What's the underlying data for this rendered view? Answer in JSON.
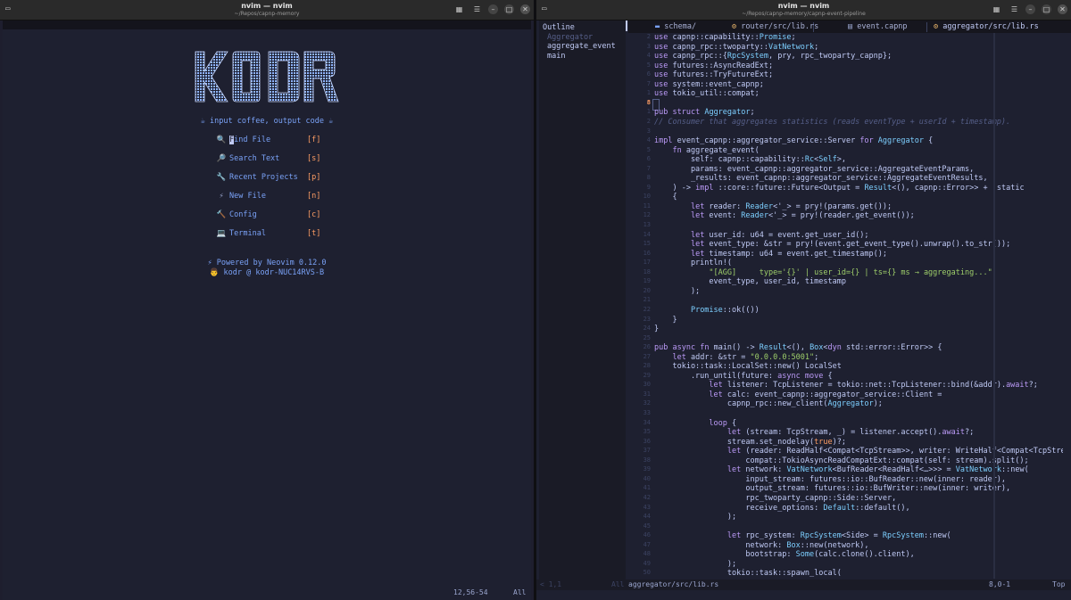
{
  "left_window": {
    "title": "nvim — nvim",
    "subtitle": "~/Repos/capnp-memory",
    "logo_text": "KODR",
    "tagline": "☕ input coffee, output code ☕",
    "menu": [
      {
        "icon": "🔍",
        "label": "Find File",
        "key": "[f]"
      },
      {
        "icon": "🔎",
        "label": "Search Text",
        "key": "[s]"
      },
      {
        "icon": "🔧",
        "label": "Recent Projects",
        "key": "[p]"
      },
      {
        "icon": "⚡",
        "label": "New File",
        "key": "[n]"
      },
      {
        "icon": "🔨",
        "label": "Config",
        "key": "[c]"
      },
      {
        "icon": "💻",
        "label": "Terminal",
        "key": "[t]"
      }
    ],
    "footer_powered": "⚡ Powered by Neovim 0.12.0",
    "footer_user": "👨 kodr @ kodr-NUC14RVS-B",
    "status_pos": "12,56-54",
    "status_all": "All"
  },
  "right_window": {
    "title": "nvim — nvim",
    "subtitle": "~/Repos/capnp-memory/capnp-event-pipeline",
    "outline": {
      "header": "Outline",
      "items": [
        "Aggregator",
        "aggregate_event",
        "main"
      ]
    },
    "tabs": [
      {
        "label": "schema/"
      },
      {
        "label": "router/src/lib.rs"
      },
      {
        "label": "event.capnp"
      },
      {
        "label": "aggregator/src/lib.rs"
      }
    ],
    "status": {
      "left": "< 1,1",
      "mid_all": "All",
      "file": "aggregator/src/lib.rs",
      "pos": "8,0-1",
      "top": "Top"
    }
  },
  "code_lines": [
    {
      "n": "2",
      "t": "use capnp::capability::Promise;"
    },
    {
      "n": "3",
      "t": "use capnp_rpc::twoparty::VatNetwork;"
    },
    {
      "n": "4",
      "t": "use capnp_rpc::{RpcSystem, pry, rpc_twoparty_capnp};"
    },
    {
      "n": "5",
      "t": "use futures::AsyncReadExt;"
    },
    {
      "n": "6",
      "t": "use futures::TryFutureExt;"
    },
    {
      "n": "7",
      "t": "use system::event_capnp;"
    },
    {
      "n": "1",
      "t": "use tokio_util::compat;"
    },
    {
      "n": "8",
      "t": "",
      "cur": true
    },
    {
      "n": "1",
      "t": "pub struct Aggregator;"
    },
    {
      "n": "2",
      "t": "// Consumer that aggregates statistics (reads eventType + userId + timestamp)."
    },
    {
      "n": "3",
      "t": ""
    },
    {
      "n": "4",
      "t": "impl event_capnp::aggregator_service::Server for Aggregator {"
    },
    {
      "n": "5",
      "t": "    fn aggregate_event("
    },
    {
      "n": "6",
      "t": "        self: capnp::capability::Rc<Self>,"
    },
    {
      "n": "7",
      "t": "        params: event_capnp::aggregator_service::AggregateEventParams,"
    },
    {
      "n": "8",
      "t": "        _results: event_capnp::aggregator_service::AggregateEventResults,"
    },
    {
      "n": "9",
      "t": "    ) -> impl ::core::future::Future<Output = Result<(), capnp::Error>> + 'static"
    },
    {
      "n": "10",
      "t": "    {"
    },
    {
      "n": "11",
      "t": "        let reader: Reader<'_> = pry!(params.get());"
    },
    {
      "n": "12",
      "t": "        let event: Reader<'_> = pry!(reader.get_event());"
    },
    {
      "n": "13",
      "t": ""
    },
    {
      "n": "14",
      "t": "        let user_id: u64 = event.get_user_id();"
    },
    {
      "n": "15",
      "t": "        let event_type: &str = pry!(event.get_event_type().unwrap().to_str());"
    },
    {
      "n": "16",
      "t": "        let timestamp: u64 = event.get_timestamp();"
    },
    {
      "n": "17",
      "t": "        println!("
    },
    {
      "n": "18",
      "t": "            \"[AGG]     type='{}' | user_id={} | ts={} ms → aggregating...\","
    },
    {
      "n": "19",
      "t": "            event_type, user_id, timestamp"
    },
    {
      "n": "20",
      "t": "        );"
    },
    {
      "n": "21",
      "t": ""
    },
    {
      "n": "22",
      "t": "        Promise::ok(())"
    },
    {
      "n": "23",
      "t": "    }"
    },
    {
      "n": "24",
      "t": "}"
    },
    {
      "n": "25",
      "t": ""
    },
    {
      "n": "26",
      "t": "pub async fn main() -> Result<(), Box<dyn std::error::Error>> {"
    },
    {
      "n": "27",
      "t": "    let addr: &str = \"0.0.0.0:5001\";"
    },
    {
      "n": "28",
      "t": "    tokio::task::LocalSet::new() LocalSet"
    },
    {
      "n": "29",
      "t": "        .run_until(future: async move {"
    },
    {
      "n": "30",
      "t": "            let listener: TcpListener = tokio::net::TcpListener::bind(&addr).await?;"
    },
    {
      "n": "31",
      "t": "            let calc: event_capnp::aggregator_service::Client ="
    },
    {
      "n": "32",
      "t": "                capnp_rpc::new_client(Aggregator);"
    },
    {
      "n": "33",
      "t": ""
    },
    {
      "n": "34",
      "t": "            loop {"
    },
    {
      "n": "35",
      "t": "                let (stream: TcpStream, _) = listener.accept().await?;"
    },
    {
      "n": "36",
      "t": "                stream.set_nodelay(true)?;"
    },
    {
      "n": "37",
      "t": "                let (reader: ReadHalf<Compat<TcpStream>>, writer: WriteHalf<Compat<TcpStream>>)"
    },
    {
      "n": "38",
      "t": "                    compat::TokioAsyncReadCompatExt::compat(self: stream).split();"
    },
    {
      "n": "39",
      "t": "                let network: VatNetwork<BufReader<ReadHalf<…>>> = VatNetwork::new("
    },
    {
      "n": "40",
      "t": "                    input_stream: futures::io::BufReader::new(inner: reader),"
    },
    {
      "n": "41",
      "t": "                    output_stream: futures::io::BufWriter::new(inner: writer),"
    },
    {
      "n": "42",
      "t": "                    rpc_twoparty_capnp::Side::Server,"
    },
    {
      "n": "43",
      "t": "                    receive_options: Default::default(),"
    },
    {
      "n": "44",
      "t": "                );"
    },
    {
      "n": "45",
      "t": ""
    },
    {
      "n": "46",
      "t": "                let rpc_system: RpcSystem<Side> = RpcSystem::new("
    },
    {
      "n": "47",
      "t": "                    network: Box::new(network),"
    },
    {
      "n": "48",
      "t": "                    bootstrap: Some(calc.clone().client),"
    },
    {
      "n": "49",
      "t": "                );"
    },
    {
      "n": "50",
      "t": "                tokio::task::spawn_local("
    }
  ],
  "colors": {
    "background": "#1e2030",
    "accent": "#7aa2f7",
    "key": "#ff9e64",
    "keyword": "#bb9af7"
  }
}
